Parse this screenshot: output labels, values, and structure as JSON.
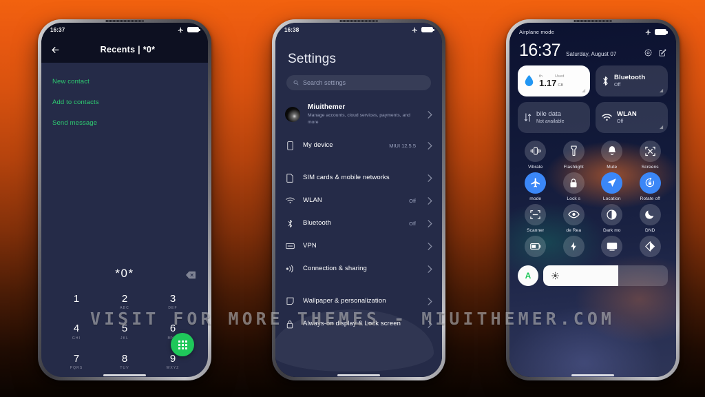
{
  "background": {
    "top_color": "#f2620f",
    "bottom_color": "#0a0401"
  },
  "watermark": {
    "text": "VISIT  FOR  MORE  THEMES  -  MIUITHEMER.COM"
  },
  "phone1": {
    "statusbar": {
      "time": "16:37",
      "icons": [
        "airplane-icon",
        "battery-icon"
      ]
    },
    "header": {
      "back": "back-arrow-icon",
      "title": "Recents  |  *0*"
    },
    "actions": [
      {
        "label": "New contact"
      },
      {
        "label": "Add to contacts"
      },
      {
        "label": "Send message"
      }
    ],
    "dial_number": "*0*",
    "keypad": [
      {
        "num": "1",
        "letters": ""
      },
      {
        "num": "2",
        "letters": "ABC"
      },
      {
        "num": "3",
        "letters": "DEF"
      },
      {
        "num": "4",
        "letters": "GHI"
      },
      {
        "num": "5",
        "letters": "JKL"
      },
      {
        "num": "6",
        "letters": "MNO"
      },
      {
        "num": "7",
        "letters": "PQRS"
      },
      {
        "num": "8",
        "letters": "TUV"
      },
      {
        "num": "9",
        "letters": "WXYZ"
      }
    ],
    "accent_green": "#2ecc71",
    "dial_button_color": "#1fc75a"
  },
  "phone2": {
    "statusbar": {
      "time": "16:38"
    },
    "title": "Settings",
    "search_placeholder": "Search settings",
    "account": {
      "name": "Miuithemer",
      "subtitle": "Manage accounts, cloud services, payments, and more"
    },
    "rows": [
      {
        "icon": "phone-device-icon",
        "label": "My device",
        "value": "MIUI 12.5.5"
      },
      {
        "icon": "sim-card-icon",
        "label": "SIM cards & mobile networks",
        "value": ""
      },
      {
        "icon": "wifi-icon",
        "label": "WLAN",
        "value": "Off"
      },
      {
        "icon": "bluetooth-icon",
        "label": "Bluetooth",
        "value": "Off"
      },
      {
        "icon": "vpn-icon",
        "label": "VPN",
        "value": ""
      },
      {
        "icon": "connection-sharing-icon",
        "label": "Connection & sharing",
        "value": ""
      },
      {
        "icon": "wallpaper-icon",
        "label": "Wallpaper & personalization",
        "value": ""
      },
      {
        "icon": "lock-icon",
        "label": "Always-on display & Lock screen",
        "value": ""
      }
    ]
  },
  "phone3": {
    "statusbar": {
      "left": "Airplane mode"
    },
    "clock": {
      "time": "16:37",
      "date": "Saturday, August 07"
    },
    "header_icons": [
      "settings-gear-icon",
      "edit-icon"
    ],
    "cards": [
      {
        "type": "data-usage",
        "top_left": "th",
        "top_right": "Used",
        "value": "1.17",
        "unit": "GB",
        "icon": "water-drop-icon"
      },
      {
        "type": "toggle",
        "title": "Bluetooth",
        "subtitle": "Off",
        "icon": "bluetooth-icon"
      },
      {
        "type": "toggle",
        "title": "bile data",
        "subtitle": "Not available",
        "icon": "mobile-data-icon"
      },
      {
        "type": "toggle",
        "title": "WLAN",
        "subtitle": "Off",
        "icon": "wifi-icon"
      }
    ],
    "toggles": [
      {
        "label": "Vibrate",
        "icon": "vibrate-icon",
        "on": false
      },
      {
        "label": "Flashlight",
        "icon": "flashlight-icon",
        "on": false
      },
      {
        "label": "Mute",
        "icon": "bell-icon",
        "on": false
      },
      {
        "label": "Screens",
        "icon": "screenshot-icon",
        "on": false
      },
      {
        "label": "mode",
        "icon": "airplane-icon",
        "on": true
      },
      {
        "label": "Lock s",
        "icon": "lock-icon",
        "on": false
      },
      {
        "label": "Location",
        "icon": "location-icon",
        "on": true
      },
      {
        "label": "Rotate off",
        "icon": "rotate-lock-icon",
        "on": true
      },
      {
        "label": "Scanner",
        "icon": "scanner-icon",
        "on": false
      },
      {
        "label": "de    Rea",
        "icon": "eye-icon",
        "on": false
      },
      {
        "label": "Dark mo",
        "icon": "dark-mode-icon",
        "on": false
      },
      {
        "label": "DND",
        "icon": "moon-icon",
        "on": false
      },
      {
        "label": "",
        "icon": "battery-saver-icon",
        "on": false
      },
      {
        "label": "",
        "icon": "ultra-battery-icon",
        "on": false
      },
      {
        "label": "",
        "icon": "cast-icon",
        "on": false
      },
      {
        "label": "",
        "icon": "contrast-icon",
        "on": false
      }
    ],
    "brightness": {
      "auto_label": "A",
      "level_percent": 60,
      "icon": "brightness-icon"
    },
    "accent_blue": "#3b87f7",
    "auto_accent": "#1fc75a"
  }
}
